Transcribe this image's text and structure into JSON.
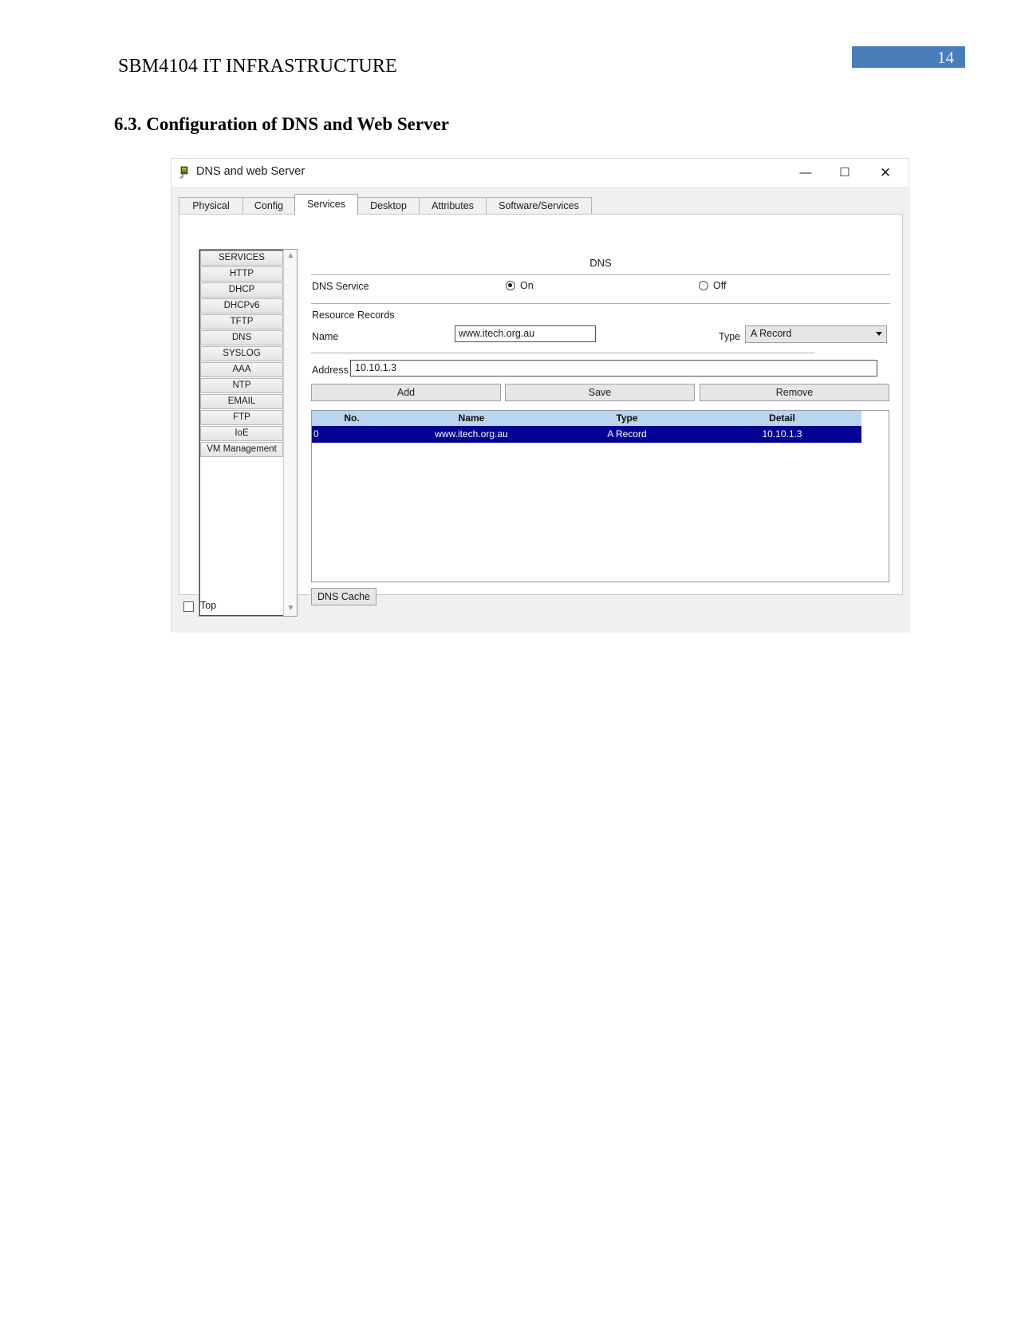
{
  "document": {
    "header_title": "SBM4104 IT INFRASTRUCTURE",
    "page_number": "14",
    "section_heading": "6.3. Configuration of DNS and Web Server",
    "accent_color": "#4a7ebb"
  },
  "window": {
    "title": "DNS and web Server",
    "icon": "device-server-icon",
    "controls": {
      "minimize": "—",
      "maximize": "☐",
      "close": "✕"
    }
  },
  "tabs": [
    {
      "label": "Physical",
      "active": false
    },
    {
      "label": "Config",
      "active": false
    },
    {
      "label": "Services",
      "active": true
    },
    {
      "label": "Desktop",
      "active": false
    },
    {
      "label": "Attributes",
      "active": false
    },
    {
      "label": "Software/Services",
      "active": false
    }
  ],
  "sidebar": {
    "items": [
      {
        "label": "SERVICES"
      },
      {
        "label": "HTTP"
      },
      {
        "label": "DHCP"
      },
      {
        "label": "DHCPv6"
      },
      {
        "label": "TFTP"
      },
      {
        "label": "DNS"
      },
      {
        "label": "SYSLOG"
      },
      {
        "label": "AAA"
      },
      {
        "label": "NTP"
      },
      {
        "label": "EMAIL"
      },
      {
        "label": "FTP"
      },
      {
        "label": "IoE"
      },
      {
        "label": "VM Management"
      }
    ],
    "scroll_up_icon": "chevron-up-icon",
    "scroll_down_icon": "chevron-down-icon"
  },
  "dns_panel": {
    "title": "DNS",
    "service_label": "DNS Service",
    "service_on_label": "On",
    "service_off_label": "Off",
    "service_state": "On",
    "resource_records_label": "Resource Records",
    "name_label": "Name",
    "name_value": "www.itech.org.au",
    "type_label": "Type",
    "type_value": "A Record",
    "address_label": "Address",
    "address_value": "10.10.1.3",
    "buttons": {
      "add": "Add",
      "save": "Save",
      "remove": "Remove",
      "dns_cache": "DNS Cache"
    },
    "table": {
      "columns": [
        "No.",
        "Name",
        "Type",
        "Detail"
      ],
      "rows": [
        {
          "no": "0",
          "name": "www.itech.org.au",
          "type": "A Record",
          "detail": "10.10.1.3",
          "selected": true
        }
      ],
      "selected_row_color": "#010194",
      "header_color": "#b9d5ef"
    }
  },
  "footer": {
    "top_checkbox_label": "Top",
    "top_checkbox_checked": false
  }
}
